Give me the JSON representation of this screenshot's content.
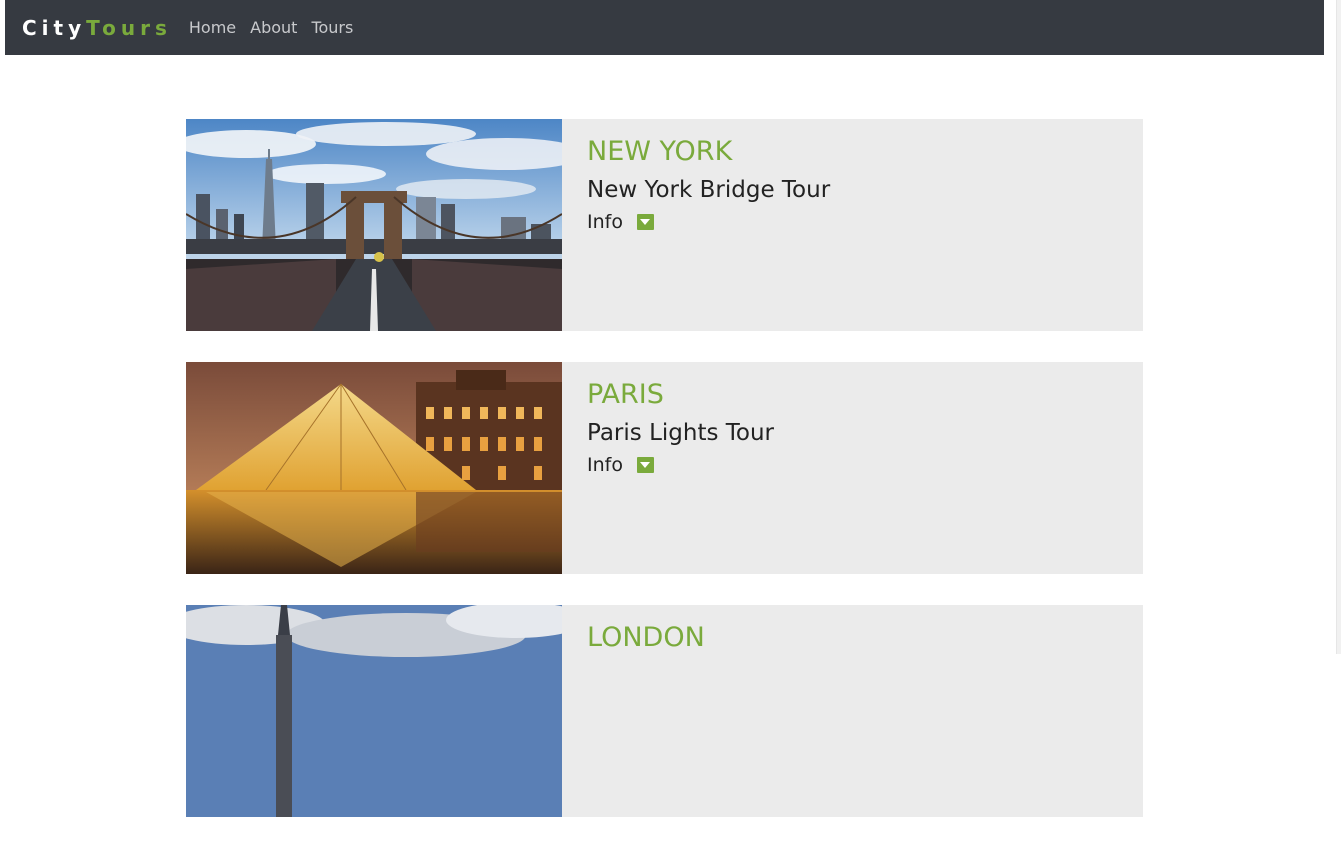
{
  "brand": {
    "part1": "City",
    "part2": "Tours"
  },
  "nav": {
    "items": [
      {
        "label": "Home"
      },
      {
        "label": "About"
      },
      {
        "label": "Tours"
      }
    ]
  },
  "tours": [
    {
      "city": "NEW YORK",
      "name": "New York Bridge Tour",
      "info_label": "Info",
      "image": "brooklyn-bridge-photo"
    },
    {
      "city": "PARIS",
      "name": "Paris Lights Tour",
      "info_label": "Info",
      "image": "louvre-pyramid-photo"
    },
    {
      "city": "LONDON",
      "name": "",
      "info_label": "",
      "image": "big-ben-photo"
    }
  ],
  "colors": {
    "navbar": "#363a41",
    "accent": "#7aaa3c",
    "card_bg": "#ebebeb"
  }
}
